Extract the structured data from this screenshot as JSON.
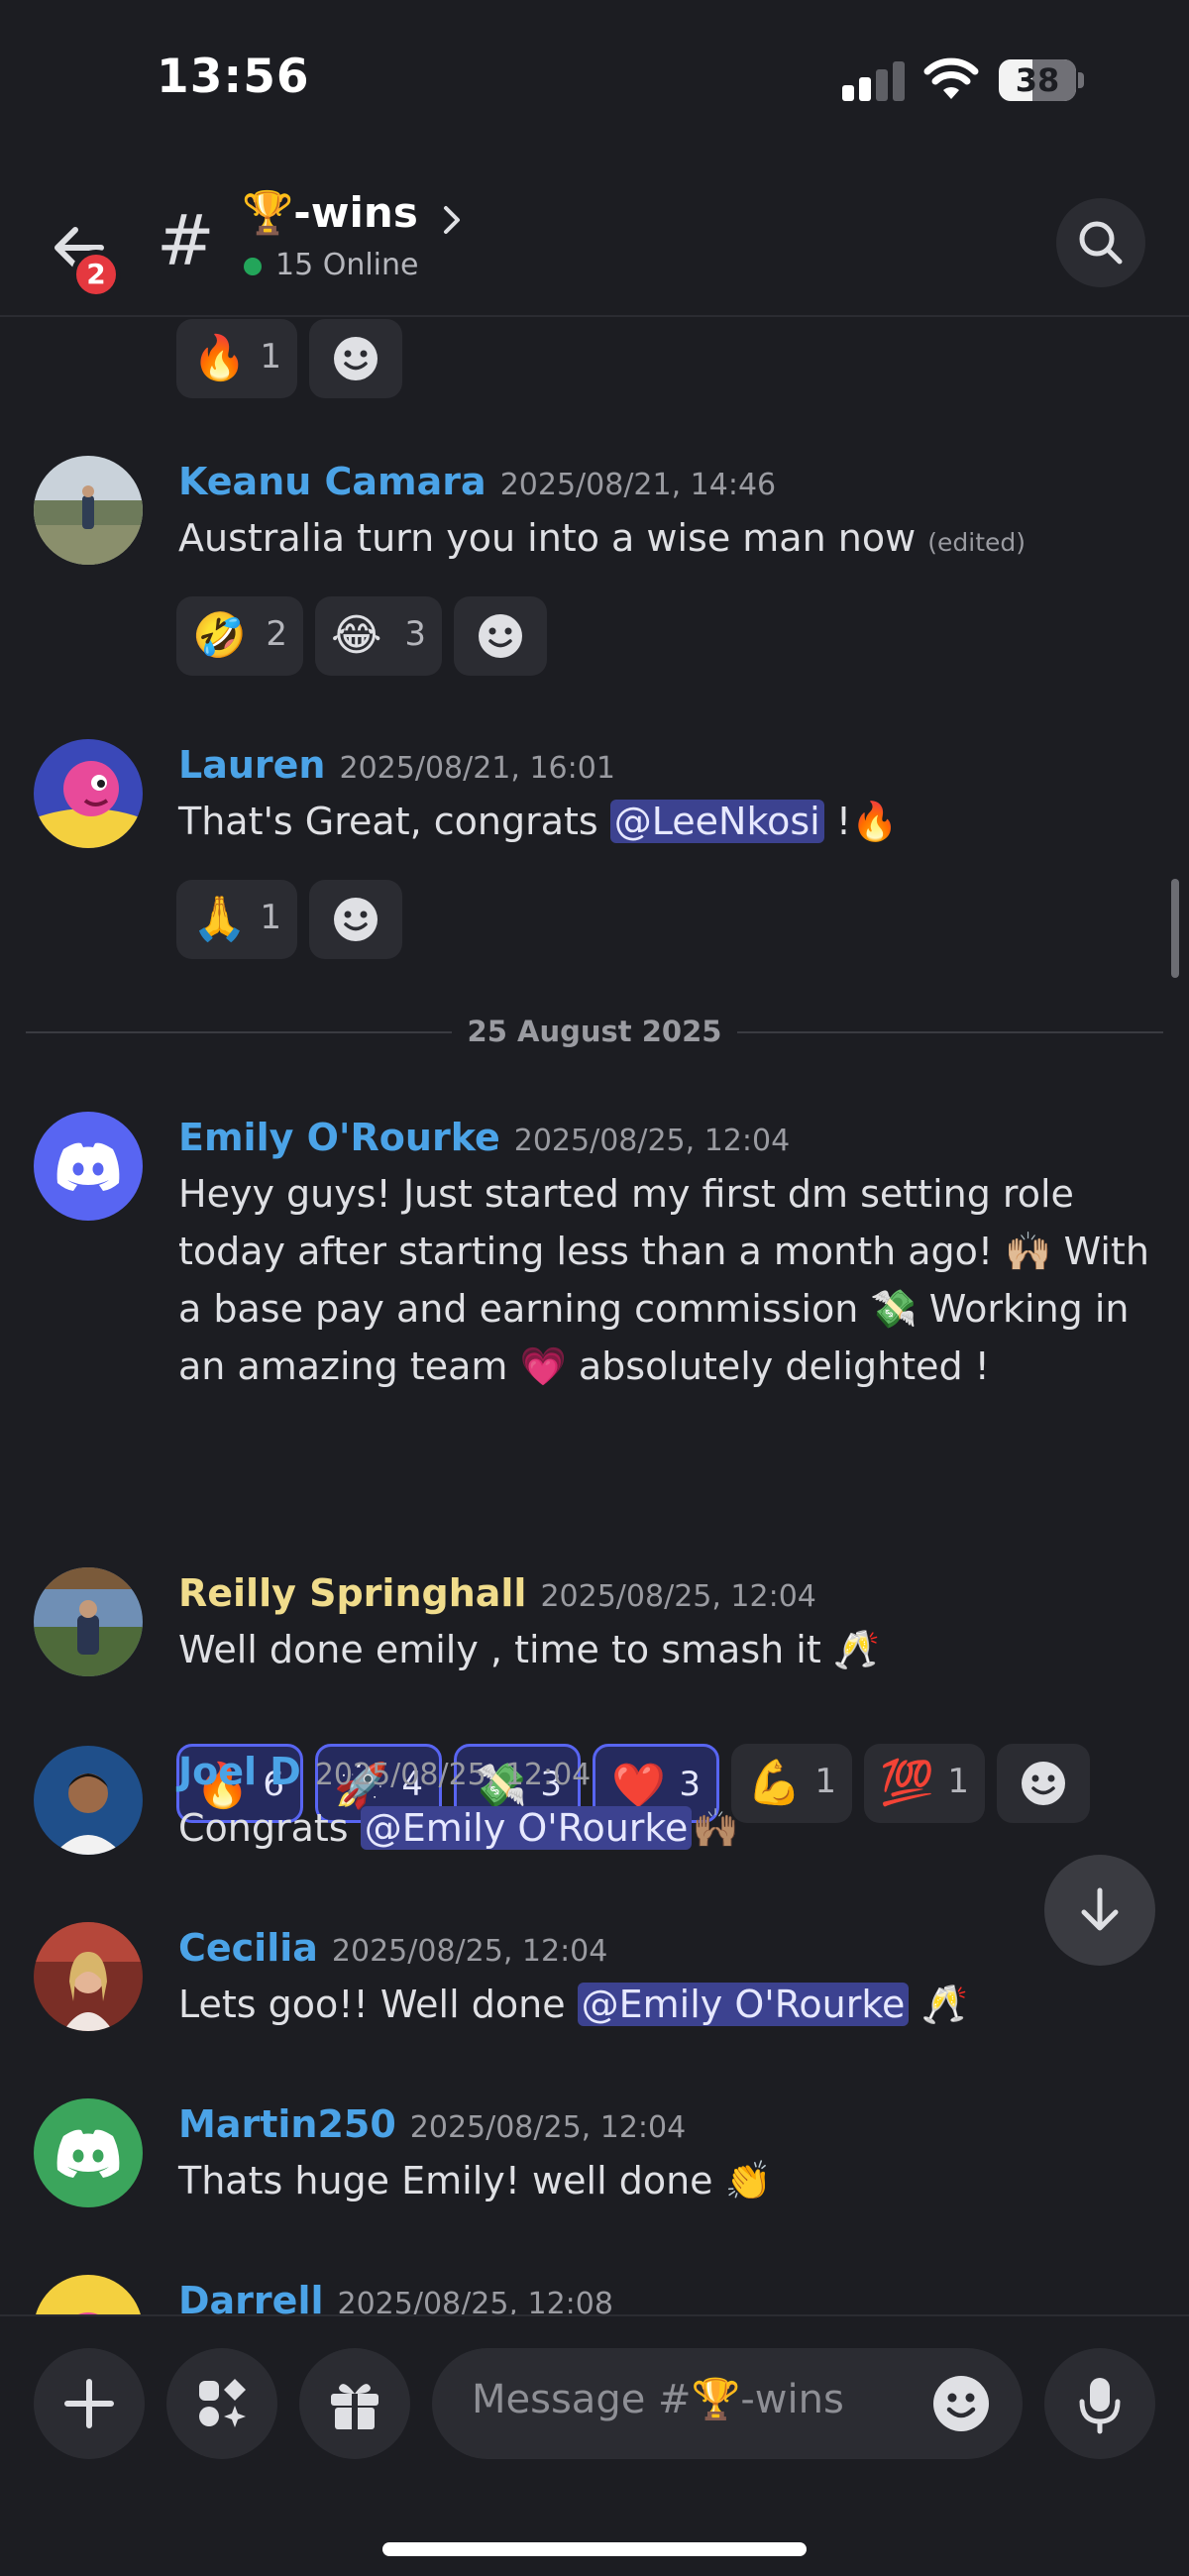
{
  "status_bar": {
    "time": "13:56",
    "battery": "38"
  },
  "header": {
    "back_badge": "2",
    "channel_name": "🏆-wins",
    "online": "15 Online"
  },
  "date_divider": "25 August 2025",
  "top_reactions": [
    {
      "emoji": "🔥",
      "count": "1"
    }
  ],
  "messages": [
    {
      "author": "Keanu Camara",
      "timestamp": "2025/08/21, 14:46",
      "text": "Australia turn you into a wise man now",
      "edited": "(edited)",
      "reactions": [
        {
          "emoji": "🤣",
          "count": "2"
        },
        {
          "emoji": "😂",
          "count": "3"
        }
      ]
    },
    {
      "author": "Lauren",
      "timestamp": "2025/08/21, 16:01",
      "text_before": "That's Great, congrats ",
      "mention": "@LeeNkosi",
      "text_after": " !🔥",
      "reactions": [
        {
          "emoji": "🙏",
          "count": "1"
        }
      ]
    },
    {
      "author": "Emily O'Rourke",
      "timestamp": "2025/08/25, 12:04",
      "lines": [
        "Heyy guys! Just started my first dm setting role",
        "today after starting less than a month ago! 🙌🏼 With",
        "a base pay and earning commission 💸 Working in",
        "an amazing team 💗 absolutely delighted !"
      ],
      "reactions": [
        {
          "emoji": "🔥",
          "count": "6"
        },
        {
          "emoji": "🚀",
          "count": "4"
        },
        {
          "emoji": "💸",
          "count": "3"
        },
        {
          "emoji": "❤️",
          "count": "3"
        },
        {
          "emoji": "💪",
          "count": "1"
        },
        {
          "emoji": "💯",
          "count": "1"
        }
      ]
    },
    {
      "author": "Reilly Springhall",
      "timestamp": "2025/08/25, 12:04",
      "text": "Well done emily , time to smash it 🥂"
    },
    {
      "author": "Joel D",
      "timestamp": "2025/08/25, 12:04",
      "text_before": "Congrats ",
      "mention": "@Emily O'Rourke",
      "text_after": "🙌🏽"
    },
    {
      "author": "Cecilia",
      "timestamp": "2025/08/25, 12:04",
      "text_before": "Lets goo!! Well done ",
      "mention": "@Emily O'Rourke",
      "text_after": " 🥂"
    },
    {
      "author": "Martin250",
      "timestamp": "2025/08/25, 12:04",
      "text": "Thats huge Emily! well done 👏"
    },
    {
      "author": "Darrell",
      "timestamp": "2025/08/25, 12:08"
    }
  ],
  "composer": {
    "placeholder": "Message #🏆-wins"
  },
  "icons": [
    "back-arrow-icon",
    "hash-icon",
    "search-icon",
    "add-reaction-icon",
    "discord-logo-icon",
    "chevron-down-icon",
    "plus-icon",
    "apps-icon",
    "gift-icon",
    "emoji-icon",
    "microphone-icon"
  ],
  "colors": {
    "background": "#1c1d22",
    "mention_bg": "#3c4290",
    "username_blue": "#4ba3e7",
    "username_gold": "#f0dc8c",
    "discord_blurple": "#5865f2",
    "online_green": "#23a55a",
    "badge_red": "#e5383f"
  }
}
